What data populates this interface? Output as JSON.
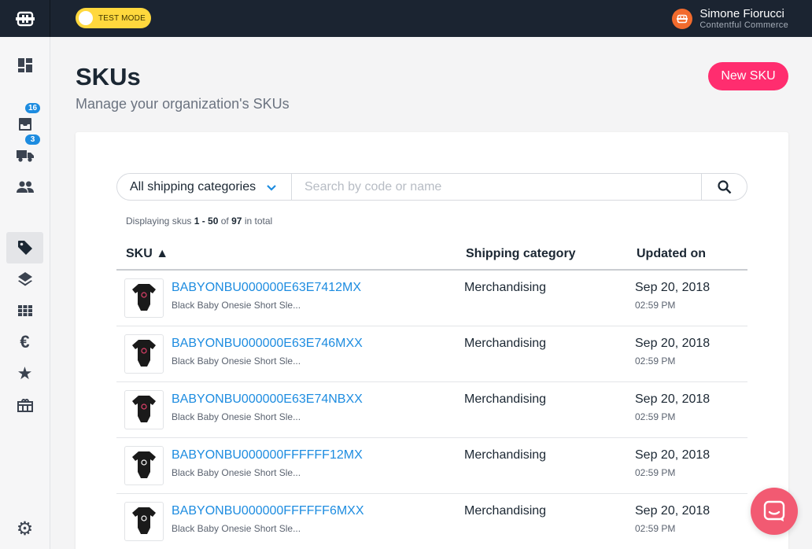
{
  "topbar": {
    "test_mode_label": "TEST MODE",
    "user_name": "Simone Fiorucci",
    "org_name": "Contentful Commerce"
  },
  "sidebar": {
    "items": [
      {
        "icon": "dashboard-icon"
      },
      {
        "icon": "orders-icon",
        "badge": "16"
      },
      {
        "icon": "shipments-icon",
        "badge": "3"
      },
      {
        "icon": "customers-icon"
      },
      {
        "icon": "skus-tag-icon",
        "active": true
      },
      {
        "icon": "layers-icon"
      },
      {
        "icon": "grid-icon"
      },
      {
        "icon": "euro-icon"
      },
      {
        "icon": "star-icon"
      },
      {
        "icon": "gift-card-icon"
      },
      {
        "icon": "settings-gear-icon"
      }
    ]
  },
  "header": {
    "title": "SKUs",
    "subtitle": "Manage your organization's SKUs",
    "new_button": "New SKU"
  },
  "filters": {
    "category_selected": "All shipping categories",
    "search_placeholder": "Search by code or name"
  },
  "pagination": {
    "prefix": "Displaying skus",
    "range": "1 - 50",
    "of": "of",
    "total": "97",
    "suffix": "in total"
  },
  "table": {
    "columns": [
      "SKU ▲",
      "Shipping category",
      "Updated on"
    ],
    "rows": [
      {
        "code": "BABYONBU000000E63E7412MX",
        "name": "Black Baby Onesie Short Sle...",
        "shipping_category": "Merchandising",
        "date": "Sep 20, 2018",
        "time": "02:59 PM",
        "print_color": "#e0406a"
      },
      {
        "code": "BABYONBU000000E63E746MXX",
        "name": "Black Baby Onesie Short Sle...",
        "shipping_category": "Merchandising",
        "date": "Sep 20, 2018",
        "time": "02:59 PM",
        "print_color": "#e0406a"
      },
      {
        "code": "BABYONBU000000E63E74NBXX",
        "name": "Black Baby Onesie Short Sle...",
        "shipping_category": "Merchandising",
        "date": "Sep 20, 2018",
        "time": "02:59 PM",
        "print_color": "#e0406a"
      },
      {
        "code": "BABYONBU000000FFFFFF12MX",
        "name": "Black Baby Onesie Short Sle...",
        "shipping_category": "Merchandising",
        "date": "Sep 20, 2018",
        "time": "02:59 PM",
        "print_color": "#ffffff"
      },
      {
        "code": "BABYONBU000000FFFFFF6MXX",
        "name": "Black Baby Onesie Short Sle...",
        "shipping_category": "Merchandising",
        "date": "Sep 20, 2018",
        "time": "02:59 PM",
        "print_color": "#ffffff"
      }
    ]
  },
  "colors": {
    "topbar_bg": "#1b2431",
    "accent_pink": "#ff2d6f",
    "link_blue": "#1d8ce0",
    "test_mode_yellow": "#ffd83d",
    "chat_button": "#f25a72"
  },
  "chat": {
    "icon": "chat-icon"
  }
}
